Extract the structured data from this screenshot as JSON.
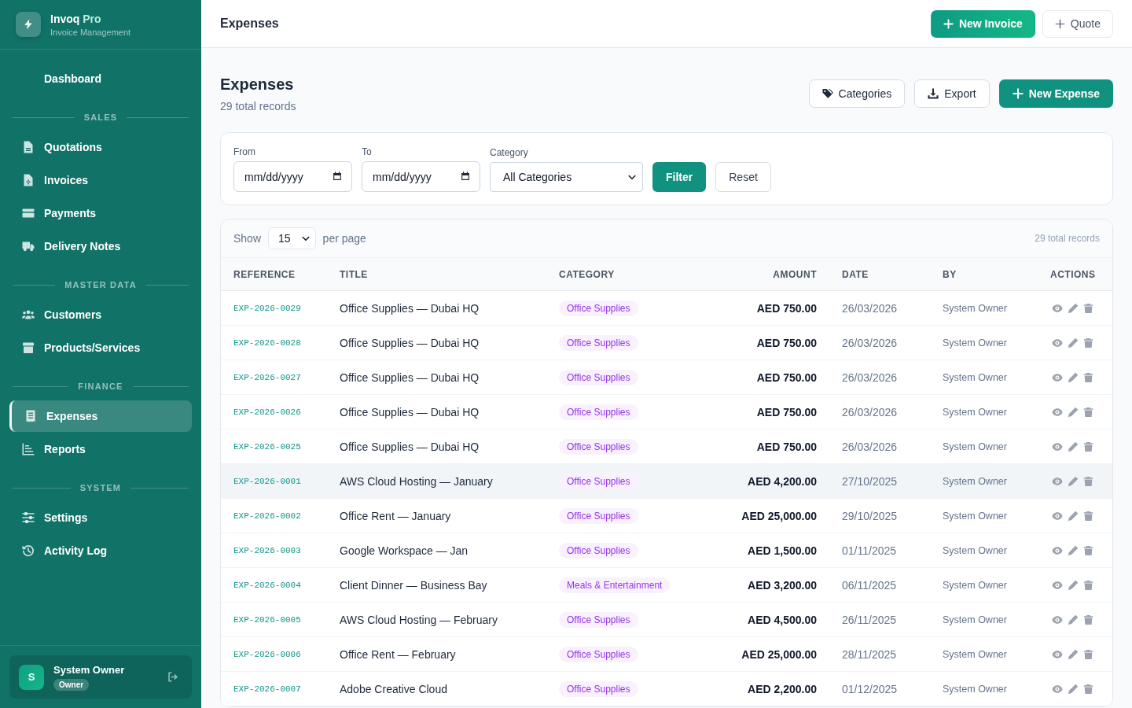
{
  "sidebar": {
    "brand": {
      "name": "Invoq",
      "name_accent": "Pro",
      "tagline": "Invoice Management"
    },
    "sections": [
      {
        "items": [
          {
            "label": "Dashboard",
            "selected": false
          }
        ]
      },
      {
        "heading": "SALES",
        "items": [
          {
            "label": "Quotations",
            "selected": false
          },
          {
            "label": "Invoices",
            "selected": false
          },
          {
            "label": "Payments",
            "selected": false
          },
          {
            "label": "Delivery Notes",
            "selected": false
          }
        ]
      },
      {
        "heading": "MASTER DATA",
        "items": [
          {
            "label": "Customers",
            "selected": false
          },
          {
            "label": "Products/Services",
            "selected": false
          }
        ]
      },
      {
        "heading": "FINANCE",
        "items": [
          {
            "label": "Expenses",
            "selected": true
          },
          {
            "label": "Reports",
            "selected": false
          }
        ]
      },
      {
        "heading": "SYSTEM",
        "items": [
          {
            "label": "Settings",
            "selected": false
          },
          {
            "label": "Activity Log",
            "selected": false
          }
        ]
      }
    ],
    "user": {
      "initial": "S",
      "name": "System Owner",
      "role": "Owner"
    }
  },
  "header": {
    "title": "Expenses",
    "actions": [
      {
        "label": "New Invoice",
        "kind": "primary"
      },
      {
        "label": "Quote",
        "kind": "outline"
      }
    ]
  },
  "page": {
    "title": "Expenses",
    "subtitle": "29 total records",
    "actions": [
      {
        "label": "Categories",
        "kind": "outline"
      },
      {
        "label": "Export",
        "kind": "outline"
      },
      {
        "label": "New Expense",
        "kind": "primary"
      }
    ]
  },
  "filters": {
    "fields": [
      {
        "kind": "date",
        "label": "From",
        "placeholder": "mm/dd/yyyy"
      },
      {
        "kind": "date",
        "label": "To",
        "placeholder": "mm/dd/yyyy"
      },
      {
        "kind": "select",
        "label": "Category",
        "value": "All Categories"
      }
    ],
    "buttons": [
      {
        "label": "Filter",
        "kind": "primary"
      },
      {
        "label": "Reset",
        "kind": "outline"
      }
    ]
  },
  "table": {
    "toolbar": {
      "show_label": "Show",
      "page_size": "15",
      "per_page_label": "per page",
      "total": "29 total records"
    },
    "columns": [
      "REFERENCE",
      "TITLE",
      "CATEGORY",
      "AMOUNT",
      "DATE",
      "BY",
      "ACTIONS"
    ],
    "rows": [
      {
        "reference": "EXP-2026-0029",
        "title": "Office Supplies — Dubai HQ",
        "category": "Office Supplies",
        "amount": "AED 750.00",
        "date": "26/03/2026",
        "by": "System Owner",
        "highlighted": false
      },
      {
        "reference": "EXP-2026-0028",
        "title": "Office Supplies — Dubai HQ",
        "category": "Office Supplies",
        "amount": "AED 750.00",
        "date": "26/03/2026",
        "by": "System Owner",
        "highlighted": false
      },
      {
        "reference": "EXP-2026-0027",
        "title": "Office Supplies — Dubai HQ",
        "category": "Office Supplies",
        "amount": "AED 750.00",
        "date": "26/03/2026",
        "by": "System Owner",
        "highlighted": false
      },
      {
        "reference": "EXP-2026-0026",
        "title": "Office Supplies — Dubai HQ",
        "category": "Office Supplies",
        "amount": "AED 750.00",
        "date": "26/03/2026",
        "by": "System Owner",
        "highlighted": false
      },
      {
        "reference": "EXP-2026-0025",
        "title": "Office Supplies — Dubai HQ",
        "category": "Office Supplies",
        "amount": "AED 750.00",
        "date": "26/03/2026",
        "by": "System Owner",
        "highlighted": false
      },
      {
        "reference": "EXP-2026-0001",
        "title": "AWS Cloud Hosting — January",
        "category": "Office Supplies",
        "amount": "AED 4,200.00",
        "date": "27/10/2025",
        "by": "System Owner",
        "highlighted": true
      },
      {
        "reference": "EXP-2026-0002",
        "title": "Office Rent — January",
        "category": "Office Supplies",
        "amount": "AED 25,000.00",
        "date": "29/10/2025",
        "by": "System Owner",
        "highlighted": false
      },
      {
        "reference": "EXP-2026-0003",
        "title": "Google Workspace — Jan",
        "category": "Office Supplies",
        "amount": "AED 1,500.00",
        "date": "01/11/2025",
        "by": "System Owner",
        "highlighted": false
      },
      {
        "reference": "EXP-2026-0004",
        "title": "Client Dinner — Business Bay",
        "category": "Meals & Entertainment",
        "amount": "AED 3,200.00",
        "date": "06/11/2025",
        "by": "System Owner",
        "highlighted": false
      },
      {
        "reference": "EXP-2026-0005",
        "title": "AWS Cloud Hosting — February",
        "category": "Office Supplies",
        "amount": "AED 4,500.00",
        "date": "26/11/2025",
        "by": "System Owner",
        "highlighted": false
      },
      {
        "reference": "EXP-2026-0006",
        "title": "Office Rent — February",
        "category": "Office Supplies",
        "amount": "AED 25,000.00",
        "date": "28/11/2025",
        "by": "System Owner",
        "highlighted": false
      },
      {
        "reference": "EXP-2026-0007",
        "title": "Adobe Creative Cloud",
        "category": "Office Supplies",
        "amount": "AED 2,200.00",
        "date": "01/12/2025",
        "by": "System Owner",
        "highlighted": false
      }
    ]
  }
}
